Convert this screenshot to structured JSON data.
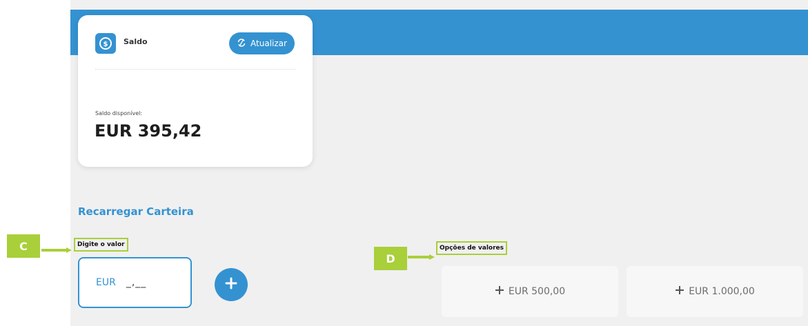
{
  "balance_card": {
    "title": "Saldo",
    "icon": "dollar-coin-icon",
    "refresh_button": "Atualizar",
    "available_label": "Saldo disponível:",
    "available_value": "EUR 395,42"
  },
  "recharge": {
    "section_title": "Recarregar Carteira",
    "input_label": "Digite o valor",
    "currency": "EUR",
    "input_mask": "_,__",
    "add_icon": "plus-icon"
  },
  "options": {
    "label": "Opções de valores",
    "items": [
      {
        "label": "EUR 500,00"
      },
      {
        "label": "EUR 1.000,00"
      }
    ]
  },
  "annotations": {
    "marker_c": "C",
    "marker_d": "D"
  },
  "colors": {
    "brand_blue": "#3492d1",
    "annotation_green": "#a9cf3a",
    "panel_bg": "#f0f0f0"
  }
}
